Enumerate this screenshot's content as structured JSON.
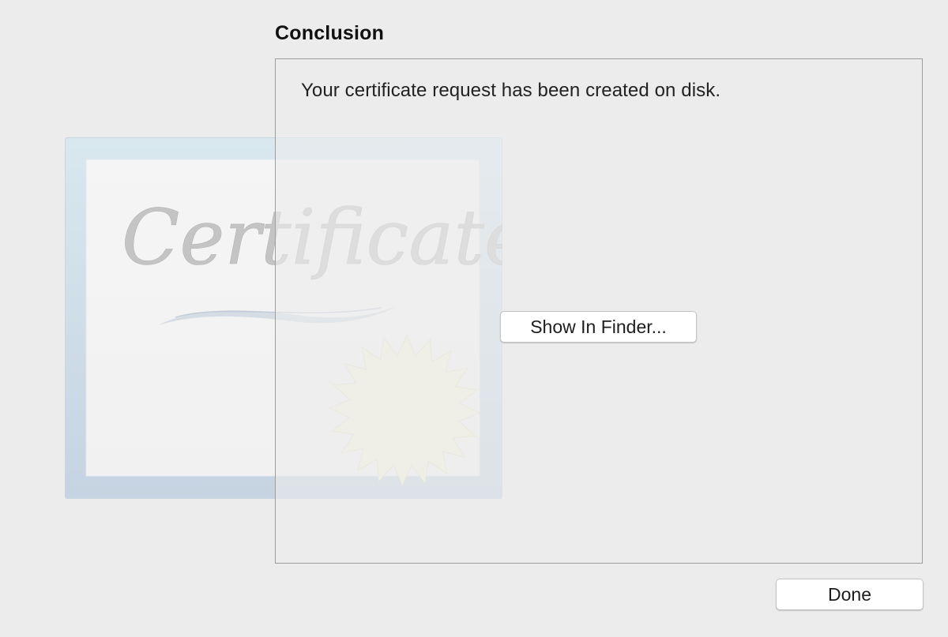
{
  "page": {
    "title": "Conclusion"
  },
  "content": {
    "message": "Your certificate request has been created on disk.",
    "show_in_finder_label": "Show In Finder..."
  },
  "footer": {
    "done_label": "Done"
  },
  "decoration": {
    "certificate_word": "Certificate",
    "icon": "certificate-icon"
  },
  "colors": {
    "background": "#ececec",
    "frame_border": "#9e9e9e",
    "certificate_frame": "#d2dde8",
    "seal": "#f4f1df"
  }
}
